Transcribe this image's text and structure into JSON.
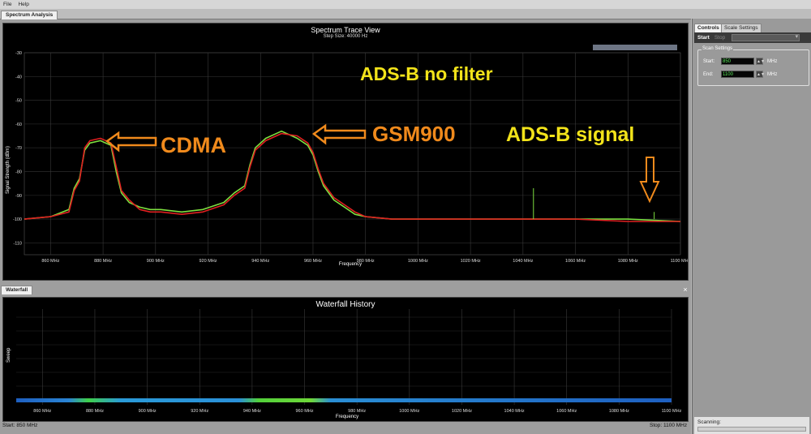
{
  "menu": {
    "file": "File",
    "help": "Help"
  },
  "main_tab": "Spectrum Analysis",
  "spectrum": {
    "title": "Spectrum Trace View",
    "subtitle": "Step Size: 40000 Hz",
    "ylabel": "Signal Strength (dBm)",
    "xlabel": "Frequency"
  },
  "annotations": {
    "title": "ADS-B no filter",
    "cdma": "CDMA",
    "gsm": "GSM900",
    "adsb": "ADS-B signal"
  },
  "waterfall": {
    "tab": "Waterfall",
    "title": "Waterfall History",
    "ylabel": "Sweep",
    "xlabel": "Frequency",
    "x_ticks": [
      "860 MHz",
      "880 MHz",
      "900 MHz",
      "920 MHz",
      "940 MHz",
      "960 MHz",
      "980 MHz",
      "1000 MHz",
      "1020 MHz",
      "1040 MHz",
      "1060 MHz",
      "1080 MHz",
      "1100 MHz"
    ]
  },
  "status": {
    "start": "Start: 850 MHz",
    "stop": "Stop: 1100 MHz"
  },
  "controls": {
    "tab_controls": "Controls",
    "tab_scale": "Scale Settings",
    "start_button": "Start",
    "stop_button": "Stop",
    "group_title": "Scan Settings",
    "start_label": "Start:",
    "start_value": "850",
    "end_label": "End:",
    "end_value": "1100",
    "unit": "MHz",
    "scanning_label": "Scanning:"
  },
  "colors": {
    "trace_red": "#e02020",
    "trace_green": "#7ee040",
    "annotation_yellow": "#f2e31a",
    "annotation_orange": "#f08a1c",
    "waterfall_blue": "#1e6fd0"
  },
  "chart_data": {
    "type": "line",
    "title": "Spectrum Trace View",
    "subtitle": "Step Size: 40000 Hz",
    "xlabel": "Frequency",
    "ylabel": "Signal Strength (dBm)",
    "x_unit": "MHz",
    "xlim": [
      850,
      1100
    ],
    "ylim": [
      -115,
      -30
    ],
    "x_ticks": [
      "860 MHz",
      "880 MHz",
      "900 MHz",
      "920 MHz",
      "940 MHz",
      "960 MHz",
      "980 MHz",
      "1000 MHz",
      "1020 MHz",
      "1040 MHz",
      "1060 MHz",
      "1080 MHz",
      "1100 MHz"
    ],
    "y_ticks": [
      -30,
      -40,
      -50,
      -60,
      -70,
      -80,
      -90,
      -100,
      -110
    ],
    "grid": true,
    "series": [
      {
        "color": "#e02020",
        "x": [
          850,
          860,
          867,
          869,
          871,
          873,
          875,
          879,
          883,
          885,
          887,
          890,
          894,
          898,
          902,
          910,
          918,
          926,
          930,
          934,
          936,
          938,
          942,
          948,
          954,
          958,
          960,
          962,
          964,
          968,
          972,
          976,
          980,
          990,
          1000,
          1020,
          1040,
          1060,
          1080,
          1100
        ],
        "y": [
          -100,
          -99,
          -97,
          -88,
          -84,
          -70,
          -67,
          -66,
          -68,
          -78,
          -88,
          -92,
          -96,
          -97,
          -97,
          -98,
          -97,
          -94,
          -90,
          -87,
          -78,
          -71,
          -67,
          -64,
          -65,
          -68,
          -72,
          -79,
          -85,
          -91,
          -94,
          -97,
          -99,
          -100,
          -100,
          -100,
          -100,
          -100,
          -101,
          -101
        ]
      },
      {
        "color": "#7ee040",
        "x": [
          850,
          860,
          867,
          869,
          871,
          873,
          875,
          879,
          883,
          885,
          887,
          890,
          894,
          898,
          902,
          910,
          918,
          926,
          930,
          934,
          936,
          938,
          942,
          948,
          954,
          958,
          960,
          962,
          964,
          968,
          972,
          976,
          980,
          990,
          1000,
          1020,
          1040,
          1060,
          1080,
          1100
        ],
        "y": [
          -100,
          -99,
          -96,
          -87,
          -83,
          -71,
          -68,
          -67,
          -69,
          -80,
          -89,
          -93,
          -95,
          -96,
          -96,
          -97,
          -96,
          -93,
          -89,
          -86,
          -77,
          -70,
          -66,
          -63,
          -66,
          -69,
          -73,
          -80,
          -86,
          -92,
          -95,
          -98,
          -99,
          -100,
          -100,
          -100,
          -100,
          -100,
          -100,
          -101
        ]
      }
    ],
    "spikes": [
      {
        "x": 1044,
        "y": -87
      },
      {
        "x": 1090,
        "y": -97
      }
    ]
  }
}
